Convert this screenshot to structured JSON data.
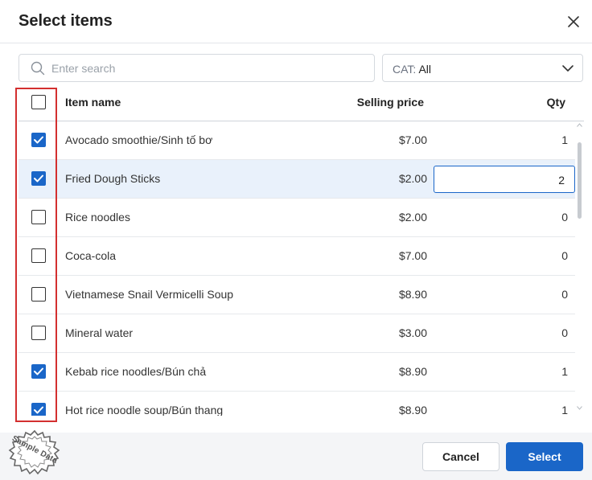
{
  "dialog": {
    "title": "Select items"
  },
  "search": {
    "placeholder": "Enter search",
    "value": ""
  },
  "category": {
    "label": "CAT:",
    "value": "All"
  },
  "table": {
    "columns": {
      "name": "Item name",
      "price": "Selling price",
      "qty": "Qty"
    },
    "select_all_checked": false,
    "rows": [
      {
        "name": "Avocado smoothie/Sinh tố bơ",
        "price": "$7.00",
        "qty": "1",
        "checked": true
      },
      {
        "name": "Fried Dough Sticks",
        "price": "$2.00",
        "qty": "2",
        "checked": true,
        "editing": true
      },
      {
        "name": "Rice noodles",
        "price": "$2.00",
        "qty": "0",
        "checked": false
      },
      {
        "name": "Coca-cola",
        "price": "$7.00",
        "qty": "0",
        "checked": false
      },
      {
        "name": "Vietnamese Snail Vermicelli Soup",
        "price": "$8.90",
        "qty": "0",
        "checked": false
      },
      {
        "name": "Mineral water",
        "price": "$3.00",
        "qty": "0",
        "checked": false
      },
      {
        "name": "Kebab rice noodles/Bún chả",
        "price": "$8.90",
        "qty": "1",
        "checked": true
      },
      {
        "name": "Hot rice noodle soup/Bún thang",
        "price": "$8.90",
        "qty": "1",
        "checked": true
      }
    ]
  },
  "footer": {
    "cancel_label": "Cancel",
    "select_label": "Select"
  },
  "watermark": {
    "text": "Sample Data"
  },
  "colors": {
    "accent": "#1a66c8",
    "highlight": "#d32f2f",
    "selected_row": "#e9f1fb"
  }
}
